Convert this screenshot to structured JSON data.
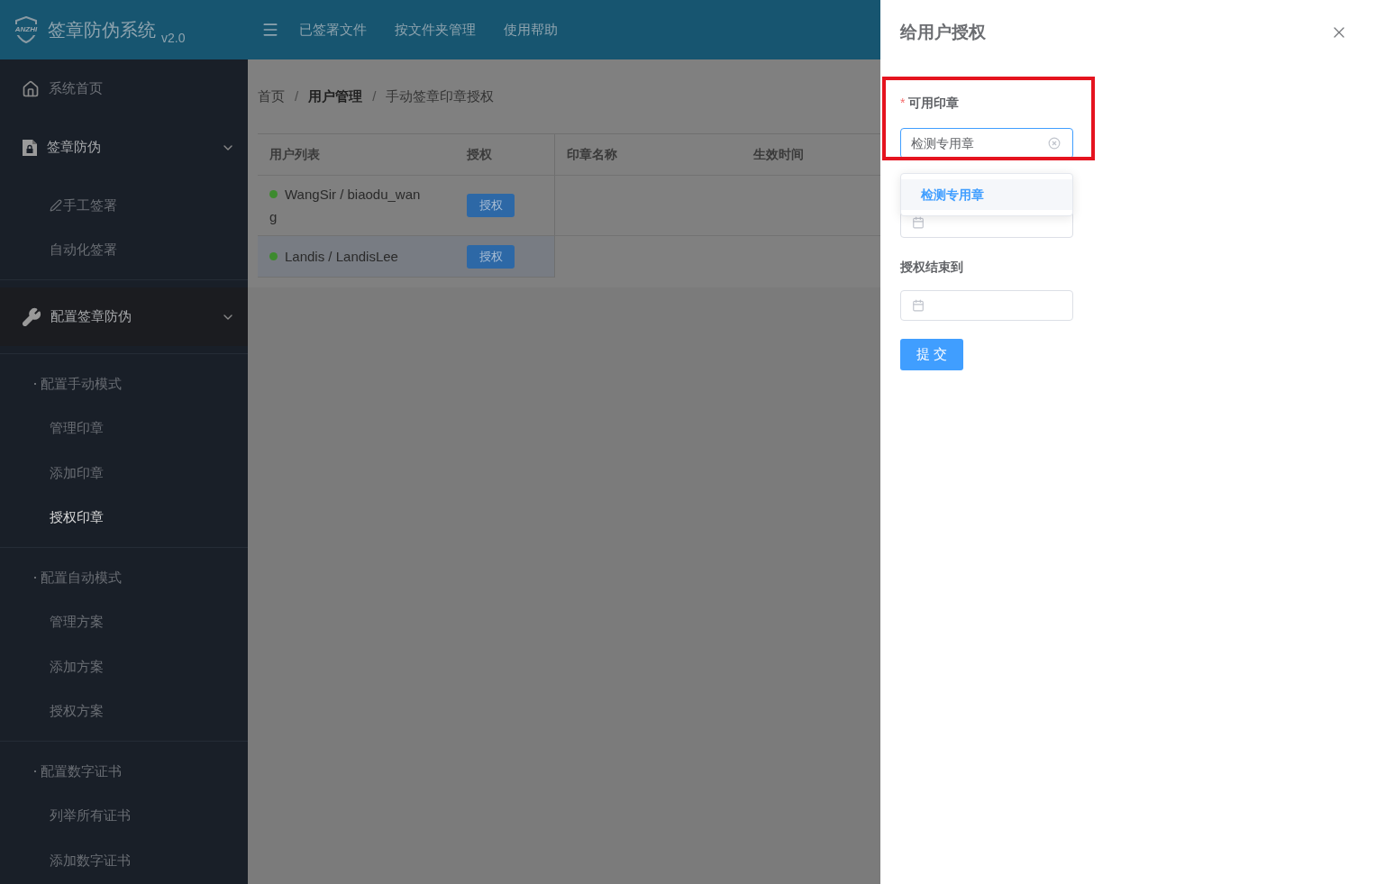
{
  "header": {
    "logo_text": "ANZHI",
    "title": "签章防伪系统",
    "version": "v2.0",
    "nav": [
      "已签署文件",
      "按文件夹管理",
      "使用帮助"
    ]
  },
  "sidebar": {
    "items": [
      {
        "kind": "link",
        "label": "系统首页",
        "selected": false
      },
      {
        "kind": "menu",
        "label": "签章防伪",
        "expanded": true,
        "highlighted": false,
        "children": [
          {
            "label": "手工签署",
            "icon": true,
            "selected": false
          },
          {
            "label": "自动化签署",
            "icon": false,
            "selected": false
          }
        ]
      },
      {
        "kind": "menu",
        "label": "配置签章防伪",
        "expanded": true,
        "highlighted": true,
        "groups": [
          {
            "label": "配置手动模式",
            "children": [
              {
                "label": "管理印章",
                "selected": false
              },
              {
                "label": "添加印章",
                "selected": false
              },
              {
                "label": "授权印章",
                "selected": true
              }
            ]
          },
          {
            "label": "配置自动模式",
            "children": [
              {
                "label": "管理方案",
                "selected": false
              },
              {
                "label": "添加方案",
                "selected": false
              },
              {
                "label": "授权方案",
                "selected": false
              }
            ]
          },
          {
            "label": "配置数字证书",
            "children": [
              {
                "label": "列举所有证书",
                "selected": false
              },
              {
                "label": "添加数字证书",
                "selected": false
              }
            ]
          }
        ]
      }
    ]
  },
  "breadcrumb": {
    "separator": "/",
    "items": [
      {
        "label": "首页",
        "link": false
      },
      {
        "label": "用户管理",
        "link": true
      },
      {
        "label": "手动签章印章授权",
        "link": false
      }
    ]
  },
  "users_table": {
    "columns": [
      "用户列表",
      "授权"
    ],
    "rows": [
      {
        "name": "WangSir / biaodu_wan",
        "name_wrap": "g",
        "color": "#3d8a2e",
        "action": "授权",
        "selected": false
      },
      {
        "name": "Landis / LandisLee",
        "color": "#3d8a2e",
        "action": "授权",
        "selected": true
      }
    ]
  },
  "stamps_table": {
    "columns": [
      "印章名称",
      "生效时间"
    ]
  },
  "drawer": {
    "title": "给用户授权",
    "fields": [
      {
        "kind": "select",
        "label": "可用印章",
        "required_mark": "*",
        "value": "检测专用章",
        "focused": true,
        "highlighted": true,
        "options": [
          {
            "label": "检测专用章",
            "selected": true
          }
        ]
      },
      {
        "kind": "date"
      },
      {
        "kind": "date",
        "label": "授权结束到"
      }
    ],
    "submit": "提 交"
  }
}
